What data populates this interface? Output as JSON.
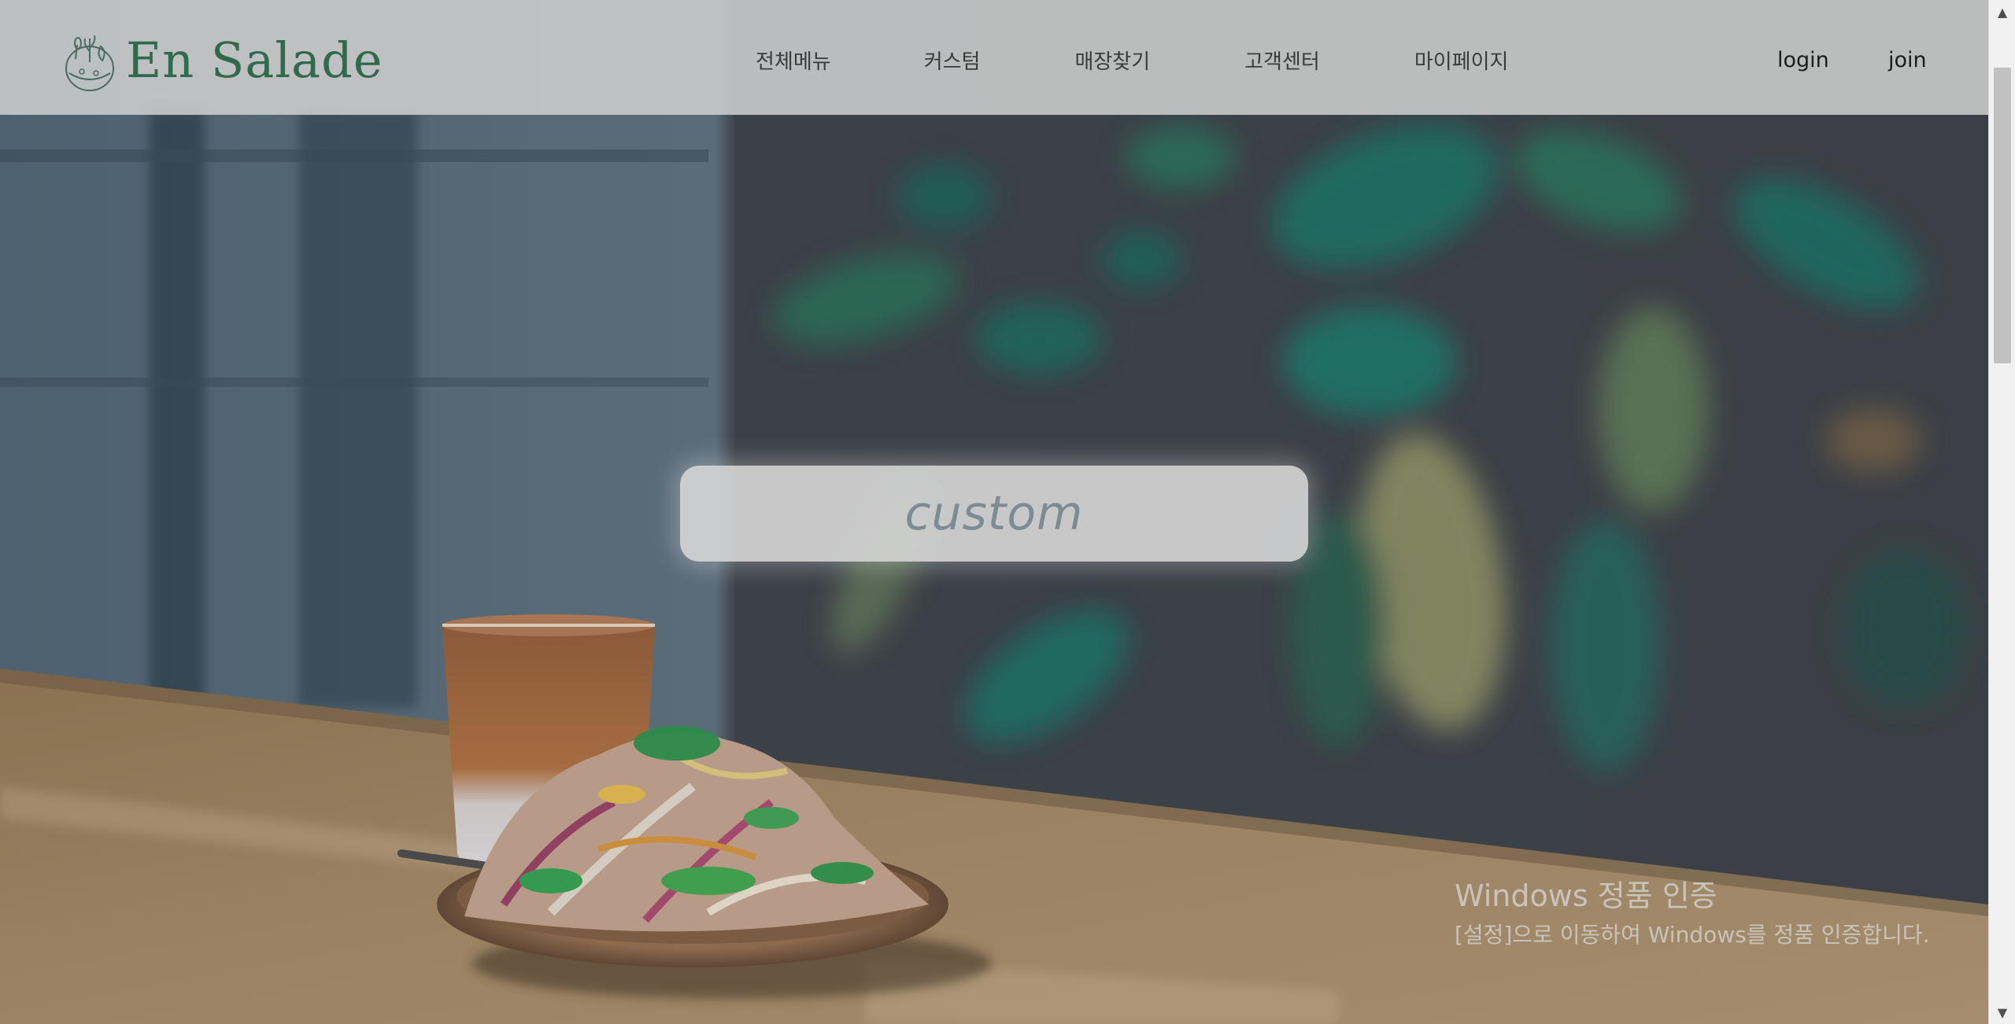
{
  "brand": {
    "name": "En Salade",
    "logo_icon": "salad-bowl-logo"
  },
  "nav": {
    "items": [
      {
        "label": "전체메뉴"
      },
      {
        "label": "커스텀"
      },
      {
        "label": "매장찾기"
      },
      {
        "label": "고객센터"
      },
      {
        "label": "마이페이지"
      }
    ]
  },
  "auth": {
    "login_label": "login",
    "join_label": "join"
  },
  "hero": {
    "cta_label": "custom"
  },
  "watermark": {
    "title": "Windows 정품 인증",
    "body": "[설정]으로 이동하여 Windows를 정품 인증합니다."
  },
  "scrollbar": {
    "up_icon": "scroll-up-arrow",
    "down_icon": "scroll-down-arrow"
  },
  "colors": {
    "brand_green": "#2f6a4f",
    "header_bg": "#cdcdcd",
    "cta_text": "#7d8c94"
  }
}
